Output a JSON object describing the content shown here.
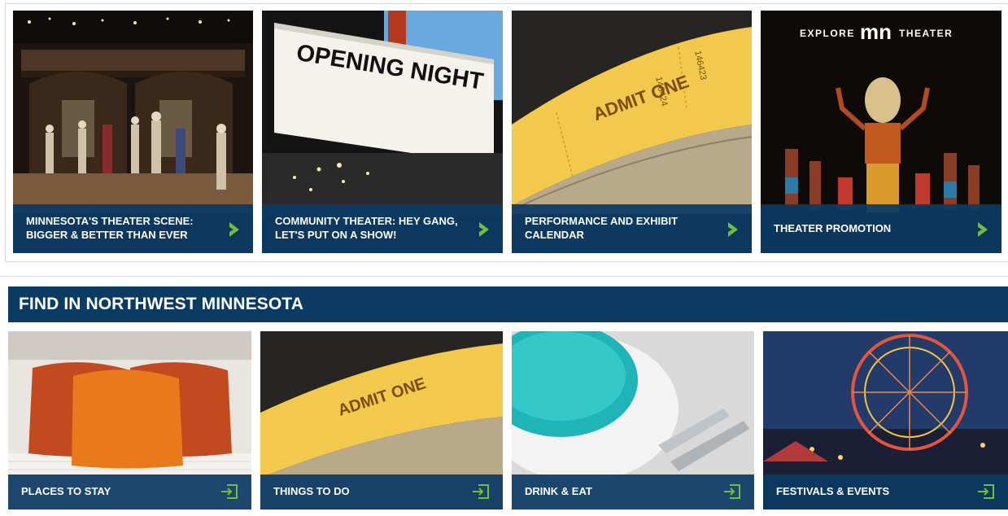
{
  "top_cards": [
    {
      "label": "MINNESOTA'S THEATER SCENE: BIGGER & BETTER THAN EVER"
    },
    {
      "label": "COMMUNITY THEATER: HEY GANG, LET'S PUT ON A SHOW!",
      "image_text": "OPENING NIGHT"
    },
    {
      "label": "PERFORMANCE AND EXHIBIT CALENDAR",
      "image_text": "ADMIT ONE",
      "ticket_numbers": [
        "146424",
        "146423",
        "146425"
      ]
    },
    {
      "label": "THEATER PROMOTION",
      "logo_left": "EXPLORE",
      "logo_mark": "mn",
      "logo_right": "THEATER"
    }
  ],
  "section": {
    "title": "FIND IN NORTHWEST MINNESOTA"
  },
  "bottom_cards": [
    {
      "label": "PLACES TO STAY"
    },
    {
      "label": "THINGS TO DO",
      "image_text": "ADMIT ONE"
    },
    {
      "label": "DRINK & EAT"
    },
    {
      "label": "FESTIVALS & EVENTS"
    }
  ],
  "colors": {
    "caption_bg": "#0c3a64",
    "header_bg": "#0b3a63",
    "arrow_green": "#6fbf3a",
    "ticket_yellow": "#f2c94c"
  },
  "icons": {
    "top_card_arrow": "chevron-right-icon",
    "bottom_card_action": "enter-icon"
  }
}
